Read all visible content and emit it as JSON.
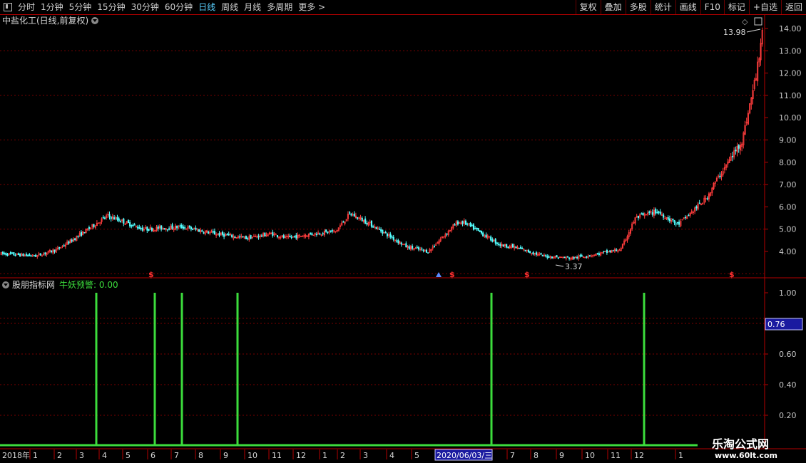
{
  "topbar": {
    "periods": [
      "分时",
      "1分钟",
      "5分钟",
      "15分钟",
      "30分钟",
      "60分钟",
      "日线",
      "周线",
      "月线",
      "多周期",
      "更多 >"
    ],
    "active_period": "日线",
    "right_buttons": [
      "复权",
      "叠加",
      "多股",
      "统计",
      "画线",
      "F10",
      "标记",
      "+自选",
      "返回"
    ]
  },
  "main_chart": {
    "title": "中盐化工(日线,前复权)",
    "high_label": "13.98",
    "low_label": "3.37",
    "y_ticks": [
      "14.00",
      "13.00",
      "12.00",
      "11.00",
      "10.00",
      "9.00",
      "8.00",
      "7.00",
      "6.00",
      "5.00",
      "4.00"
    ],
    "event_marker": "$"
  },
  "indicator": {
    "name": "股朋指标网",
    "series_label": "牛妖预警: 0.00",
    "y_ticks": [
      "1.00",
      "0.80",
      "0.60",
      "0.40",
      "0.20"
    ],
    "cursor_value": "0.76"
  },
  "time_axis": {
    "start_label": "2018年",
    "month_labels": [
      "1",
      "2",
      "3",
      "4",
      "5",
      "6",
      "7",
      "8",
      "9",
      "10",
      "11",
      "12",
      "1",
      "2",
      "3",
      "4",
      "5",
      "7",
      "8",
      "9",
      "10",
      "11",
      "12",
      "1",
      "2",
      "3",
      "4"
    ],
    "cursor_date": "2020/06/03/三"
  },
  "watermark": {
    "name": "乐淘公式网",
    "url": "www.60lt.com"
  },
  "colors": {
    "up": "#ff3c3c",
    "down": "#54ffff",
    "signal": "#3cdc3c",
    "grid": "#7a0000",
    "frame": "#b40000"
  },
  "chart_data": {
    "type": "candlestick+bar",
    "price_anchors": {
      "x_index": [
        0,
        50,
        80,
        100,
        150,
        200,
        255,
        300,
        345,
        380,
        400,
        440,
        470,
        490,
        520,
        540,
        570,
        600,
        640,
        650,
        700,
        720,
        760,
        800,
        840,
        870,
        890,
        920,
        950,
        990,
        1000,
        1010,
        1020,
        1040,
        1060,
        1068,
        1075
      ],
      "close": [
        3.9,
        3.8,
        4.1,
        4.5,
        5.6,
        5.0,
        5.1,
        4.8,
        4.6,
        4.8,
        4.6,
        4.8,
        4.9,
        5.7,
        5.2,
        4.8,
        4.2,
        4.0,
        5.3,
        5.3,
        4.3,
        4.2,
        3.8,
        3.7,
        3.9,
        4.1,
        5.5,
        5.8,
        5.2,
        6.4,
        7.0,
        7.5,
        8.0,
        9.0,
        12.0,
        13.9,
        11.5
      ]
    },
    "signal_x_index": [
      135,
      217,
      255,
      333,
      689,
      903
    ],
    "signal_value": 1.0,
    "price_ylim": [
      3.2,
      14.2
    ],
    "indicator_ylim": [
      0,
      1.1
    ]
  }
}
